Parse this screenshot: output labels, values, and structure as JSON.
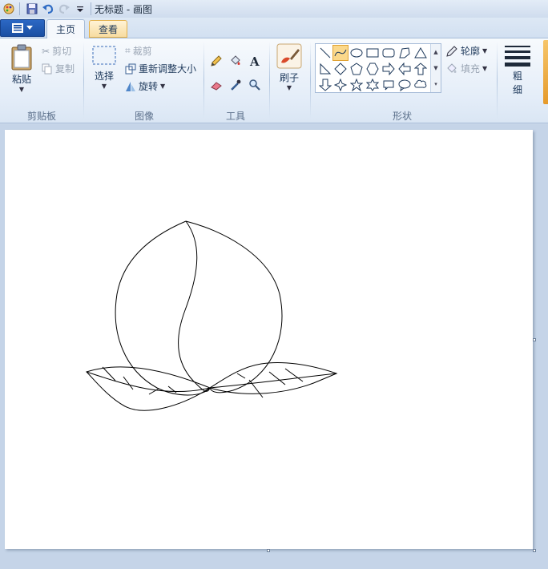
{
  "window": {
    "title": "无标题 - 画图"
  },
  "tabs": {
    "home": "主页",
    "view": "查看"
  },
  "clipboard": {
    "paste": "粘贴",
    "cut": "剪切",
    "copy": "复制",
    "label": "剪贴板"
  },
  "image": {
    "select": "选择",
    "crop": "裁剪",
    "resize": "重新调整大小",
    "rotate": "旋转",
    "label": "图像"
  },
  "tools": {
    "label": "工具"
  },
  "brushes": {
    "label": "刷子"
  },
  "shapes": {
    "outline": "轮廓",
    "fill": "填充",
    "label": "形状"
  },
  "size": {
    "label_line1": "粗",
    "label_line2": "细"
  },
  "colors": {
    "accent": "#1a4fa3",
    "selected": "#fbd88b",
    "ribbon_text": "#1e395b"
  }
}
